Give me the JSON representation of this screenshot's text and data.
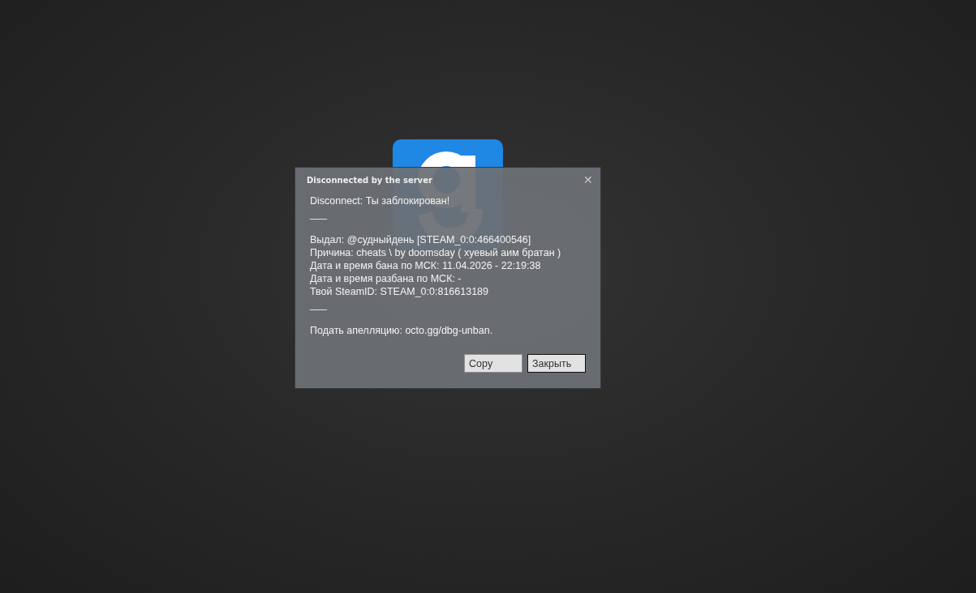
{
  "dialog": {
    "title": "Disconnected by the server",
    "close": "✕",
    "paragraphs": [
      [
        "Disconnect: Ты заблокирован!",
        "___"
      ],
      [
        "Выдал: @судныйдень [STEAM_0:0:466400546]",
        "Причина: cheats \\ by doomsday ( хуевый аим братан )",
        "Дата и время бана по МСК: 11.04.2026 - 22:19:38",
        "Дата и время разбана по МСК: -",
        "Твой SteamID: STEAM_0:0:816613189",
        "___"
      ],
      [
        "Подать апелляцию: octo.gg/dbg-unban."
      ]
    ],
    "buttons": [
      {
        "label": "Copy",
        "focused": false
      },
      {
        "label": "Закрыть",
        "focused": true
      }
    ]
  }
}
